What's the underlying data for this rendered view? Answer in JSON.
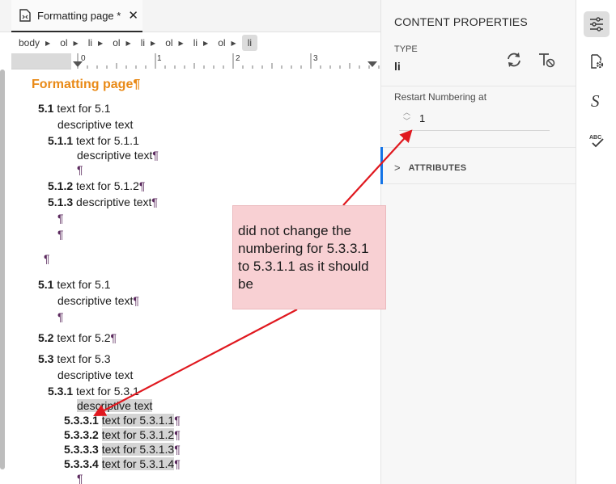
{
  "tab": {
    "title": "Formatting page *",
    "close": "✕"
  },
  "breadcrumb": [
    "body",
    "ol",
    "li",
    "ol",
    "li",
    "ol",
    "li",
    "ol",
    "li"
  ],
  "ruler": {
    "marks": [
      "0",
      "1",
      "2",
      "3"
    ]
  },
  "document": {
    "title": "Formatting page",
    "pilcrow": "¶",
    "lines": [
      {
        "num": "5.1",
        "text": "text for 5.1",
        "pil": ""
      },
      {
        "num": "",
        "text": "descriptive text",
        "pil": ""
      },
      {
        "num": "5.1.1",
        "text": "text for 5.1.1",
        "pil": ""
      },
      {
        "num": "",
        "text": "descriptive text",
        "pil": "¶"
      },
      {
        "num": "",
        "text": "",
        "pil": "¶"
      },
      {
        "num": "5.1.2",
        "text": "text for 5.1.2",
        "pil": "¶"
      },
      {
        "num": "5.1.3",
        "text": "descriptive text",
        "pil": "¶"
      },
      {
        "num": "",
        "text": "",
        "pil": "¶"
      },
      {
        "num": "",
        "text": "",
        "pil": "¶"
      },
      {
        "num": "",
        "text": "",
        "pil": "¶"
      },
      {
        "num": "5.1",
        "text": "text for 5.1",
        "pil": ""
      },
      {
        "num": "",
        "text": "descriptive text",
        "pil": "¶"
      },
      {
        "num": "",
        "text": "",
        "pil": "¶"
      },
      {
        "num": "5.2",
        "text": "text for 5.2",
        "pil": "¶"
      },
      {
        "num": "5.3",
        "text": "text for 5.3",
        "pil": ""
      },
      {
        "num": "",
        "text": "descriptive text",
        "pil": ""
      },
      {
        "num": "5.3.1",
        "text": "text for 5.3.1",
        "pil": ""
      },
      {
        "num": "",
        "text": "descriptive text",
        "pil": ""
      },
      {
        "num": "5.3.3.1",
        "text": "text for 5.3.1.1",
        "pil": "¶"
      },
      {
        "num": "5.3.3.2",
        "text": "text for 5.3.1.2",
        "pil": "¶"
      },
      {
        "num": "5.3.3.3",
        "text": "text for 5.3.1.3",
        "pil": "¶"
      },
      {
        "num": "5.3.3.4",
        "text": "text for 5.3.1.4",
        "pil": "¶"
      },
      {
        "num": "",
        "text": "",
        "pil": "¶"
      }
    ]
  },
  "panel": {
    "title": "CONTENT PROPERTIES",
    "type_label": "TYPE",
    "type_value": "li",
    "restart_label": "Restart Numbering at",
    "restart_value": "1",
    "attributes_label": "ATTRIBUTES"
  },
  "annotation": {
    "text": "did not change the numbering for 5.3.3.1 to 5.3.1.1 as it should be",
    "color": "#e0181f"
  },
  "icons": {
    "tab": "document-icon",
    "refresh": "refresh-icon",
    "clear_format": "clear-format-icon",
    "rail": [
      "sliders-icon",
      "document-settings-icon",
      "styles-icon",
      "spellcheck-icon"
    ]
  },
  "colors": {
    "title": "#e98a17",
    "highlight": "#d4d4d4",
    "accent": "#1473e6",
    "callout_bg": "#f8d0d3"
  }
}
